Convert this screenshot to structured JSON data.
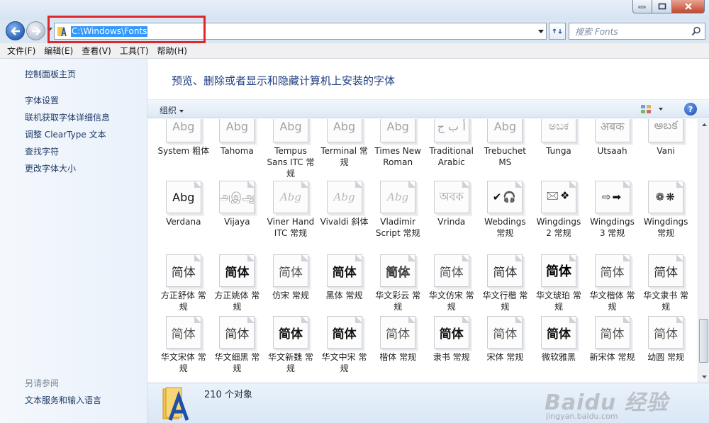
{
  "window": {
    "buttons": [
      "minimize-button",
      "maximize-button",
      "close-button"
    ]
  },
  "address": {
    "path": "C:\\Windows\\Fonts",
    "search_placeholder": "搜索 Fonts"
  },
  "menu": [
    "文件(F)",
    "编辑(E)",
    "查看(V)",
    "工具(T)",
    "帮助(H)"
  ],
  "sidebar": {
    "home": "控制面板主页",
    "links": [
      "字体设置",
      "联机获取字体详细信息",
      "调整 ClearType 文本",
      "查找字符",
      "更改字体大小"
    ],
    "see_also_heading": "另请参阅",
    "see_also_links": [
      "文本服务和输入语言"
    ]
  },
  "banner": "预览、删除或者显示和隐藏计算机上安装的字体",
  "toolbar": {
    "organize": "组织",
    "help": "?"
  },
  "fonts": [
    {
      "label": "System 粗体",
      "glyph": "Abg",
      "style": "latin",
      "faded": true
    },
    {
      "label": "Tahoma",
      "glyph": "Abg",
      "style": "latin",
      "faded": true
    },
    {
      "label": "Tempus Sans ITC 常规",
      "glyph": "Abg",
      "style": "latin",
      "faded": true
    },
    {
      "label": "Terminal 常规",
      "glyph": "Abg",
      "style": "latin",
      "faded": true
    },
    {
      "label": "Times New Roman",
      "glyph": "Abg",
      "style": "latin",
      "faded": true
    },
    {
      "label": "Traditional Arabic",
      "glyph": "أ ب ج",
      "style": "latin",
      "faded": true
    },
    {
      "label": "Trebuchet MS",
      "glyph": "Abg",
      "style": "latin",
      "faded": true
    },
    {
      "label": "Tunga",
      "glyph": "ಅಬಕ",
      "style": "latin",
      "faded": true
    },
    {
      "label": "Utsaah",
      "glyph": "अबक",
      "style": "latin",
      "faded": true
    },
    {
      "label": "Vani",
      "glyph": "అబక",
      "style": "latin",
      "faded": true
    },
    {
      "label": "Verdana",
      "glyph": "Abg",
      "style": "latin",
      "faded": false
    },
    {
      "label": "Vijaya",
      "glyph": "அஇஆ",
      "style": "latin",
      "faded": true
    },
    {
      "label": "Viner Hand ITC 常规",
      "glyph": "Abg",
      "style": "script",
      "faded": true
    },
    {
      "label": "Vivaldi 斜体",
      "glyph": "Abg",
      "style": "script",
      "faded": true
    },
    {
      "label": "Vladimir Script 常规",
      "glyph": "Abg",
      "style": "script",
      "faded": true
    },
    {
      "label": "Vrinda",
      "glyph": "অবক",
      "style": "latin",
      "faded": true
    },
    {
      "label": "Webdings 常规",
      "glyph": "✔🎧",
      "style": "symbol",
      "faded": false
    },
    {
      "label": "Wingdings 2 常规",
      "glyph": "🖂❖",
      "style": "symbol",
      "faded": false
    },
    {
      "label": "Wingdings 3 常规",
      "glyph": "⇨➡",
      "style": "symbol",
      "faded": false
    },
    {
      "label": "Wingdings 常规",
      "glyph": "❁❋",
      "style": "symbol",
      "faded": false
    },
    {
      "label": "方正舒体 常规",
      "glyph": "简体",
      "style": "cjk",
      "faded": false
    },
    {
      "label": "方正姚体 常规",
      "glyph": "简体",
      "style": "cjk-bold",
      "faded": false
    },
    {
      "label": "仿宋 常规",
      "glyph": "简体",
      "style": "cjk-light",
      "faded": false
    },
    {
      "label": "黑体 常规",
      "glyph": "简体",
      "style": "cjk-bold",
      "faded": false
    },
    {
      "label": "华文彩云 常规",
      "glyph": "简体",
      "style": "cjk-outline",
      "faded": false
    },
    {
      "label": "华文仿宋 常规",
      "glyph": "简体",
      "style": "cjk-light",
      "faded": false
    },
    {
      "label": "华文行楷 常规",
      "glyph": "简体",
      "style": "cjk",
      "faded": false
    },
    {
      "label": "华文琥珀 常规",
      "glyph": "简体",
      "style": "cjk-heavy",
      "faded": false
    },
    {
      "label": "华文楷体 常规",
      "glyph": "简体",
      "style": "cjk-light",
      "faded": false
    },
    {
      "label": "华文隶书 常规",
      "glyph": "简体",
      "style": "cjk",
      "faded": false
    },
    {
      "label": "华文宋体 常规",
      "glyph": "简体",
      "style": "cjk-light",
      "faded": false
    },
    {
      "label": "华文细黑 常规",
      "glyph": "简体",
      "style": "cjk",
      "faded": false
    },
    {
      "label": "华文新魏 常规",
      "glyph": "简体",
      "style": "cjk-bold",
      "faded": false
    },
    {
      "label": "华文中宋 常规",
      "glyph": "简体",
      "style": "cjk-bold",
      "faded": false
    },
    {
      "label": "楷体 常规",
      "glyph": "简体",
      "style": "cjk-light",
      "faded": false
    },
    {
      "label": "隶书 常规",
      "glyph": "简体",
      "style": "cjk-bold",
      "faded": false
    },
    {
      "label": "宋体 常规",
      "glyph": "简体",
      "style": "cjk-light",
      "faded": false
    },
    {
      "label": "微软雅黑",
      "glyph": "简体",
      "style": "cjk-bold",
      "faded": false
    },
    {
      "label": "新宋体 常规",
      "glyph": "简体",
      "style": "cjk-light",
      "faded": false
    },
    {
      "label": "幼圆 常规",
      "glyph": "简体",
      "style": "cjk-light",
      "faded": false
    }
  ],
  "details": {
    "count": "210 个对象"
  },
  "watermark": {
    "text": "Baidu 经验",
    "url": "jingyan.baidu.com"
  },
  "colors": {
    "highlight_border": "#e0262b",
    "selection": "#3399ff",
    "banner_text": "#1e3d80"
  }
}
